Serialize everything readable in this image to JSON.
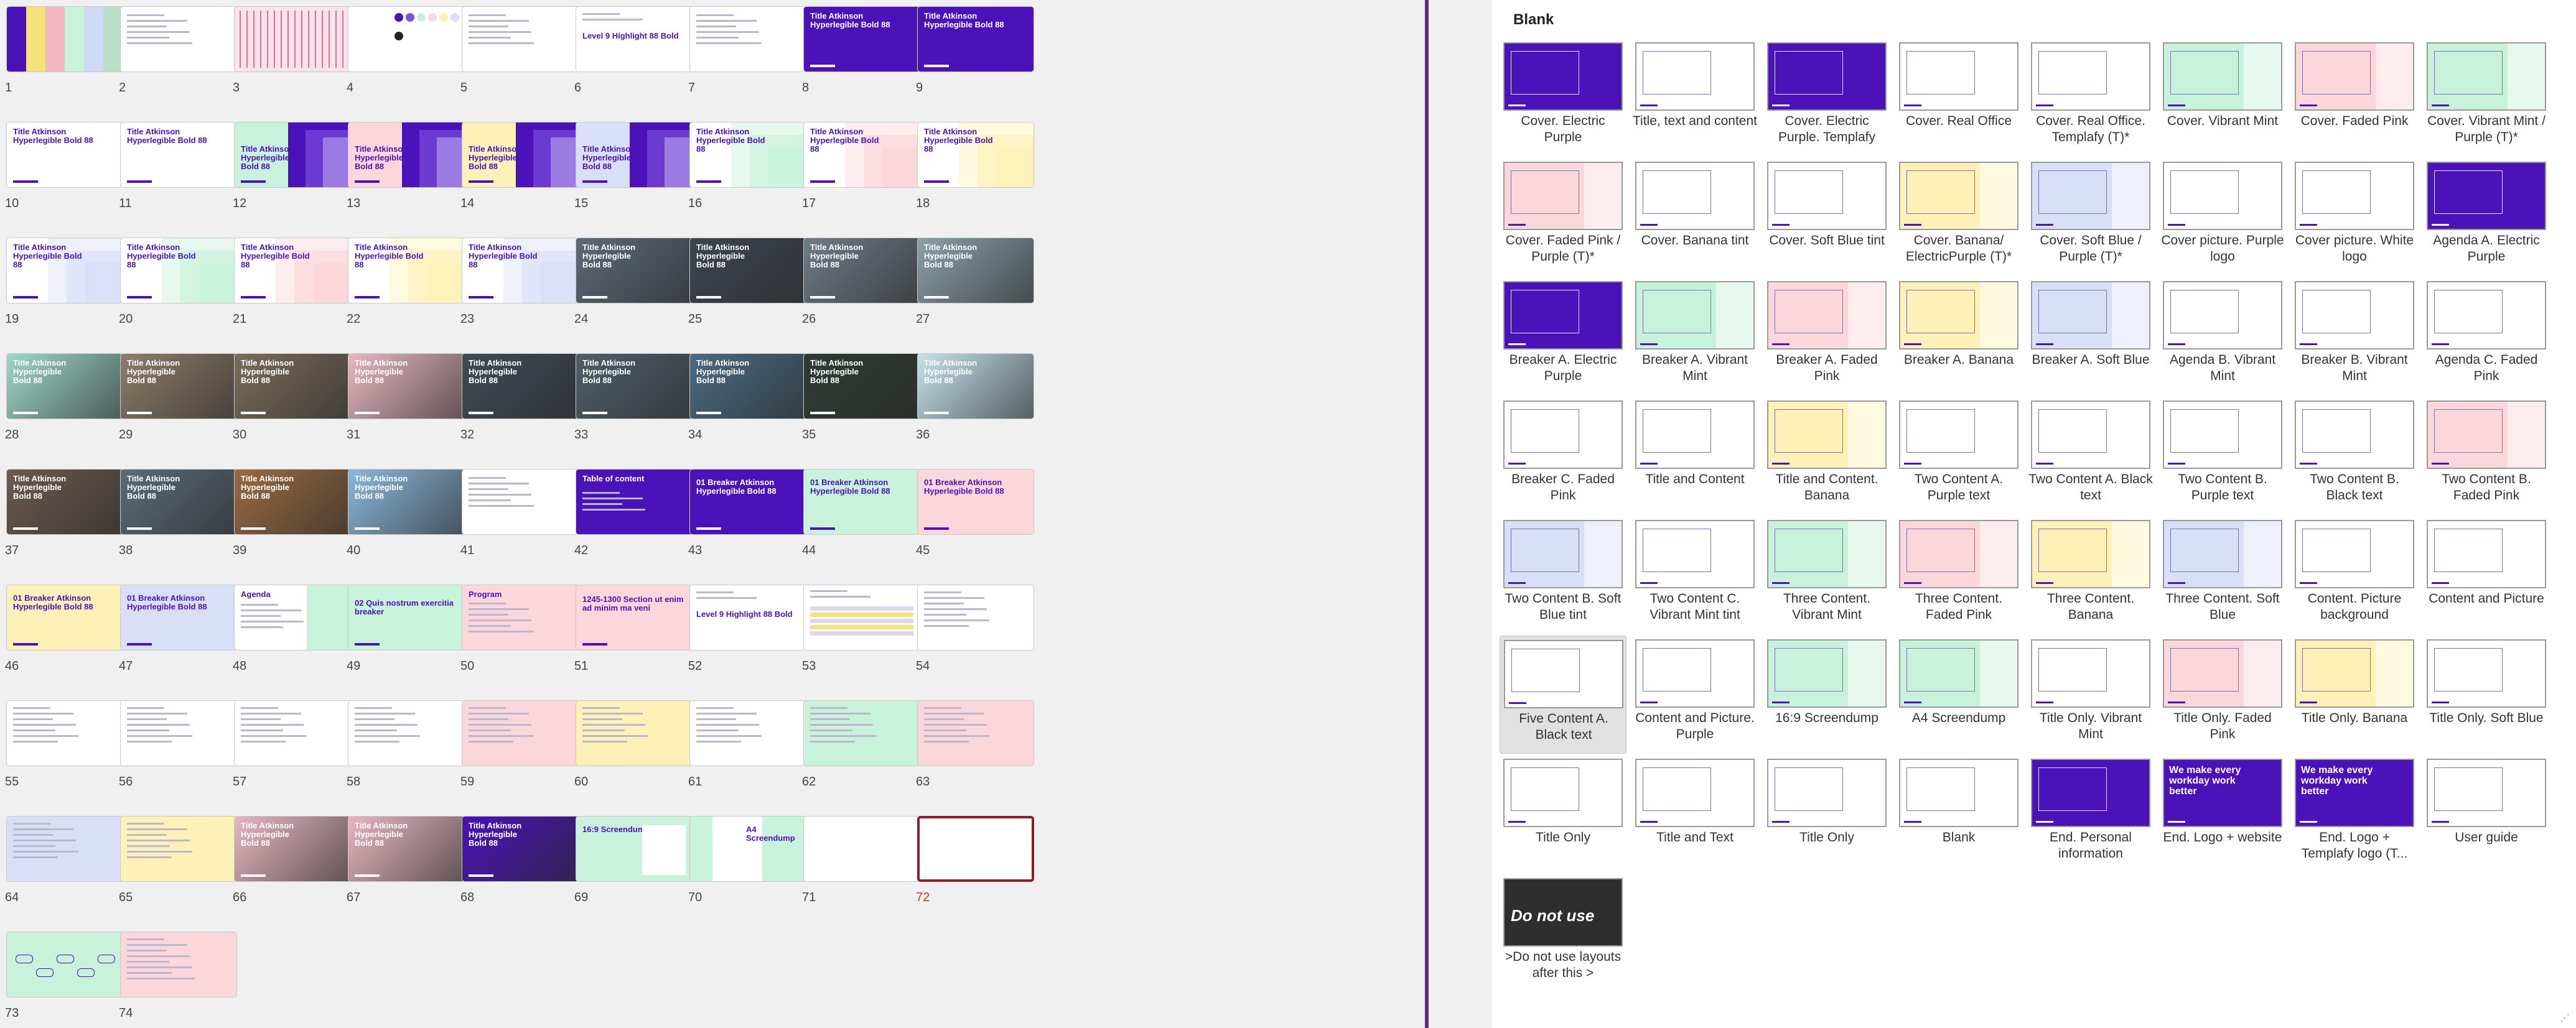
{
  "colors": {
    "purple": "#4a12b8",
    "mint": "#c9f2dc",
    "pink": "#fbd6da",
    "banana": "#fdf1b8",
    "blue": "#dadff8",
    "selected_border": "#8b1d2c",
    "divider": "#5d2a8c"
  },
  "sorter": {
    "title_text": "Title Atkinson Hyperlegible Bold 88",
    "breaker_text": "01 Breaker Atkinson Hyperlegible Bold 88",
    "agenda_text": "Agenda",
    "quis_text": "02 Quis nostrum exercitia breaker",
    "program_text": "Program",
    "section_text": "1245-1300 Section ut enim ad minim ma veni",
    "toc_text": "Table of content",
    "screendump_text": "16:9 Screendump",
    "a4_text": "A4 Screendump",
    "level_text": "Level 9 Highlight 88 Bold",
    "slides": [
      {
        "n": "1",
        "kind": "colors"
      },
      {
        "n": "2",
        "kind": "doc"
      },
      {
        "n": "3",
        "kind": "stripes"
      },
      {
        "n": "4",
        "kind": "palette"
      },
      {
        "n": "5",
        "kind": "doc"
      },
      {
        "n": "6",
        "kind": "level"
      },
      {
        "n": "7",
        "kind": "doc"
      },
      {
        "n": "8",
        "kind": "title",
        "bg": "purple",
        "white": true
      },
      {
        "n": "9",
        "kind": "title",
        "bg": "purple",
        "white": true
      },
      {
        "n": "10",
        "kind": "title",
        "bg": "white"
      },
      {
        "n": "11",
        "kind": "title",
        "bg": "white"
      },
      {
        "n": "12",
        "kind": "stepped",
        "bg": "mint"
      },
      {
        "n": "13",
        "kind": "stepped",
        "bg": "pink"
      },
      {
        "n": "14",
        "kind": "stepped",
        "bg": "banana"
      },
      {
        "n": "15",
        "kind": "stepped",
        "bg": "blue"
      },
      {
        "n": "16",
        "kind": "steps",
        "bg": "mint"
      },
      {
        "n": "17",
        "kind": "steps",
        "bg": "pink"
      },
      {
        "n": "18",
        "kind": "steps",
        "bg": "banana"
      },
      {
        "n": "19",
        "kind": "steps",
        "bg": "blue"
      },
      {
        "n": "20",
        "kind": "steps",
        "bg": "mint"
      },
      {
        "n": "21",
        "kind": "steps",
        "bg": "pink"
      },
      {
        "n": "22",
        "kind": "steps",
        "bg": "banana"
      },
      {
        "n": "23",
        "kind": "steps",
        "bg": "blue"
      },
      {
        "n": "24",
        "kind": "photo",
        "tone": "#5d6a78"
      },
      {
        "n": "25",
        "kind": "photo",
        "tone": "#3e4550"
      },
      {
        "n": "26",
        "kind": "photo",
        "tone": "#6f7b86"
      },
      {
        "n": "27",
        "kind": "photo",
        "tone": "#8aa0a8"
      },
      {
        "n": "28",
        "kind": "photo",
        "tone": "#9ed8c8"
      },
      {
        "n": "29",
        "kind": "photo",
        "tone": "#8c7d68"
      },
      {
        "n": "30",
        "kind": "photo",
        "tone": "#7a6d5a"
      },
      {
        "n": "31",
        "kind": "photo",
        "tone": "#e8b7c0"
      },
      {
        "n": "32",
        "kind": "photo",
        "tone": "#404a55"
      },
      {
        "n": "33",
        "kind": "photo",
        "tone": "#4f5f6a"
      },
      {
        "n": "34",
        "kind": "photo",
        "tone": "#4a6b82"
      },
      {
        "n": "35",
        "kind": "photo",
        "tone": "#2f3b33"
      },
      {
        "n": "36",
        "kind": "photo",
        "tone": "#c5e2ec"
      },
      {
        "n": "37",
        "kind": "photo",
        "tone": "#6a5a50"
      },
      {
        "n": "38",
        "kind": "photo",
        "tone": "#5b6b77"
      },
      {
        "n": "39",
        "kind": "photo",
        "tone": "#9a6a3f"
      },
      {
        "n": "40",
        "kind": "photo",
        "tone": "#8ab8dc"
      },
      {
        "n": "41",
        "kind": "doc"
      },
      {
        "n": "42",
        "kind": "toc"
      },
      {
        "n": "43",
        "kind": "breaker",
        "bg": "purple",
        "white": true
      },
      {
        "n": "44",
        "kind": "breaker",
        "bg": "mint"
      },
      {
        "n": "45",
        "kind": "breaker",
        "bg": "pink"
      },
      {
        "n": "46",
        "kind": "breaker",
        "bg": "banana"
      },
      {
        "n": "47",
        "kind": "breaker",
        "bg": "blue"
      },
      {
        "n": "48",
        "kind": "agenda",
        "bg": "mint"
      },
      {
        "n": "49",
        "kind": "quis",
        "bg": "mint"
      },
      {
        "n": "50",
        "kind": "program",
        "bg": "pink"
      },
      {
        "n": "51",
        "kind": "section",
        "bg": "pink"
      },
      {
        "n": "52",
        "kind": "level",
        "bg": "white"
      },
      {
        "n": "53",
        "kind": "table"
      },
      {
        "n": "54",
        "kind": "text",
        "bg": "white"
      },
      {
        "n": "55",
        "kind": "text",
        "bg": "white"
      },
      {
        "n": "56",
        "kind": "text",
        "bg": "white"
      },
      {
        "n": "57",
        "kind": "text",
        "bg": "white"
      },
      {
        "n": "58",
        "kind": "text",
        "bg": "white"
      },
      {
        "n": "59",
        "kind": "text",
        "bg": "pink"
      },
      {
        "n": "60",
        "kind": "text",
        "bg": "banana"
      },
      {
        "n": "61",
        "kind": "text",
        "bg": "white"
      },
      {
        "n": "62",
        "kind": "text",
        "bg": "mint"
      },
      {
        "n": "63",
        "kind": "text",
        "bg": "pink"
      },
      {
        "n": "64",
        "kind": "text",
        "bg": "blue"
      },
      {
        "n": "65",
        "kind": "text",
        "bg": "banana"
      },
      {
        "n": "66",
        "kind": "photo",
        "tone": "#e8b7c0"
      },
      {
        "n": "67",
        "kind": "photo",
        "tone": "#e8b7c0"
      },
      {
        "n": "68",
        "kind": "photo",
        "tone": "#4a12b8"
      },
      {
        "n": "69",
        "kind": "screendump",
        "bg": "mint"
      },
      {
        "n": "70",
        "kind": "a4",
        "bg": "mint"
      },
      {
        "n": "71",
        "kind": "blank"
      },
      {
        "n": "72",
        "kind": "blank",
        "selected": true
      },
      {
        "n": "73",
        "kind": "flow",
        "bg": "mint"
      },
      {
        "n": "74",
        "kind": "list",
        "bg": "pink"
      }
    ]
  },
  "gallery": {
    "title": "Blank",
    "layouts": [
      {
        "label": "Cover. Electric Purple",
        "bg": "purple"
      },
      {
        "label": "Title, text and content",
        "bg": "white"
      },
      {
        "label": "Cover. Electric Purple. Templafy",
        "bg": "purple"
      },
      {
        "label": "Cover. Real Office",
        "bg": "white"
      },
      {
        "label": "Cover. Real Office. Templafy (T)*",
        "bg": "white"
      },
      {
        "label": "Cover. Vibrant Mint",
        "bg": "mint"
      },
      {
        "label": "Cover. Faded Pink",
        "bg": "pink"
      },
      {
        "label": "Cover. Vibrant Mint / Purple (T)*",
        "bg": "mint"
      },
      {
        "label": "Cover. Faded Pink / Purple (T)*",
        "bg": "pink"
      },
      {
        "label": "Cover. Banana tint",
        "bg": "white"
      },
      {
        "label": "Cover. Soft Blue tint",
        "bg": "white"
      },
      {
        "label": "Cover. Banana/ ElectricPurple (T)*",
        "bg": "banana"
      },
      {
        "label": "Cover. Soft Blue / Purple (T)*",
        "bg": "blue"
      },
      {
        "label": "Cover picture. Purple logo",
        "bg": "white"
      },
      {
        "label": "Cover picture. White logo",
        "bg": "white"
      },
      {
        "label": "Agenda A. Electric Purple",
        "bg": "purple"
      },
      {
        "label": "Breaker A. Electric Purple",
        "bg": "purple"
      },
      {
        "label": "Breaker A. Vibrant Mint",
        "bg": "mint"
      },
      {
        "label": "Breaker A. Faded Pink",
        "bg": "pink"
      },
      {
        "label": "Breaker A. Banana",
        "bg": "banana"
      },
      {
        "label": "Breaker A. Soft Blue",
        "bg": "blue"
      },
      {
        "label": "Agenda B. Vibrant Mint",
        "bg": "white"
      },
      {
        "label": "Breaker B. Vibrant Mint",
        "bg": "white"
      },
      {
        "label": "Agenda C. Faded Pink",
        "bg": "white"
      },
      {
        "label": "Breaker C. Faded Pink",
        "bg": "white"
      },
      {
        "label": "Title and Content",
        "bg": "white"
      },
      {
        "label": "Title and Content. Banana",
        "bg": "banana"
      },
      {
        "label": "Two Content A. Purple text",
        "bg": "white"
      },
      {
        "label": "Two Content A. Black text",
        "bg": "white"
      },
      {
        "label": "Two Content B. Purple text",
        "bg": "white"
      },
      {
        "label": "Two Content B. Black text",
        "bg": "white"
      },
      {
        "label": "Two Content B. Faded Pink",
        "bg": "pink"
      },
      {
        "label": "Two Content B. Soft Blue tint",
        "bg": "blue"
      },
      {
        "label": "Two Content C. Vibrant Mint tint",
        "bg": "white"
      },
      {
        "label": "Three Content. Vibrant Mint",
        "bg": "mint"
      },
      {
        "label": "Three Content. Faded Pink",
        "bg": "pink"
      },
      {
        "label": "Three Content. Banana",
        "bg": "banana"
      },
      {
        "label": "Three Content. Soft Blue",
        "bg": "blue"
      },
      {
        "label": "Content. Picture background",
        "bg": "white"
      },
      {
        "label": "Content and Picture",
        "bg": "white"
      },
      {
        "label": "Five Content A. Black text",
        "bg": "white",
        "highlight": true
      },
      {
        "label": "Content and Picture. Purple",
        "bg": "white"
      },
      {
        "label": "16:9 Screendump",
        "bg": "mint"
      },
      {
        "label": "A4 Screendump",
        "bg": "mint"
      },
      {
        "label": "Title Only. Vibrant Mint",
        "bg": "white"
      },
      {
        "label": "Title Only. Faded Pink",
        "bg": "pink"
      },
      {
        "label": "Title Only. Banana",
        "bg": "banana"
      },
      {
        "label": "Title Only. Soft Blue",
        "bg": "white"
      },
      {
        "label": "Title Only",
        "bg": "white"
      },
      {
        "label": "Title and Text",
        "bg": "white"
      },
      {
        "label": "Title Only",
        "bg": "white"
      },
      {
        "label": "Blank",
        "bg": "white"
      },
      {
        "label": "End. Personal information",
        "bg": "purple"
      },
      {
        "label": "End. Logo + website",
        "bg": "purple",
        "text": "We make every workday work better"
      },
      {
        "label": "End. Logo + Templafy logo (T...",
        "bg": "purple",
        "text": "We make every workday work better"
      },
      {
        "label": "User guide",
        "bg": "white"
      },
      {
        "label": ">Do not use layouts after this >",
        "bg": "dark",
        "text": "Do not use"
      }
    ]
  }
}
